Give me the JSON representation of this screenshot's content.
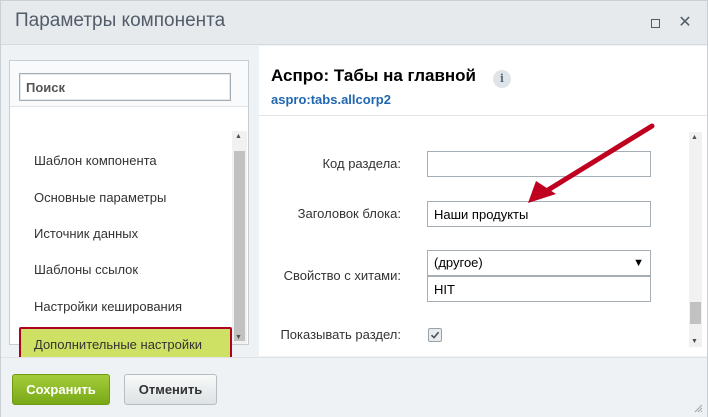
{
  "window": {
    "title": "Параметры компонента",
    "maximize_icon": "maximize-icon",
    "close_icon": "close-icon",
    "close_glyph": "✕"
  },
  "sidebar": {
    "search_placeholder": "Поиск",
    "items": [
      {
        "label": "Шаблон компонента"
      },
      {
        "label": "Основные параметры"
      },
      {
        "label": "Источник данных"
      },
      {
        "label": "Шаблоны ссылок"
      },
      {
        "label": "Настройки кеширования"
      },
      {
        "label": "Дополнительные настройки",
        "highlighted": true
      }
    ]
  },
  "component": {
    "title": "Аспро: Табы на главной",
    "code": "aspro:tabs.allcorp2",
    "info_glyph": "i"
  },
  "form": {
    "section_code_label": "Код раздела:",
    "section_code_value": "",
    "block_title_label": "Заголовок блока:",
    "block_title_value": "Наши продукты",
    "hits_property_label": "Свойство с хитами:",
    "hits_property_selected": "(другое)",
    "hits_property_custom": "HIT",
    "show_section_label": "Показывать раздел:",
    "show_section_checked": true
  },
  "footer": {
    "save_label": "Сохранить",
    "cancel_label": "Отменить"
  },
  "colors": {
    "highlight_fill": "#cfe164",
    "highlight_border": "#b0001f",
    "annotation_arrow": "#c0001f",
    "save_button": "#8cbb1f",
    "component_code": "#2067b0"
  }
}
